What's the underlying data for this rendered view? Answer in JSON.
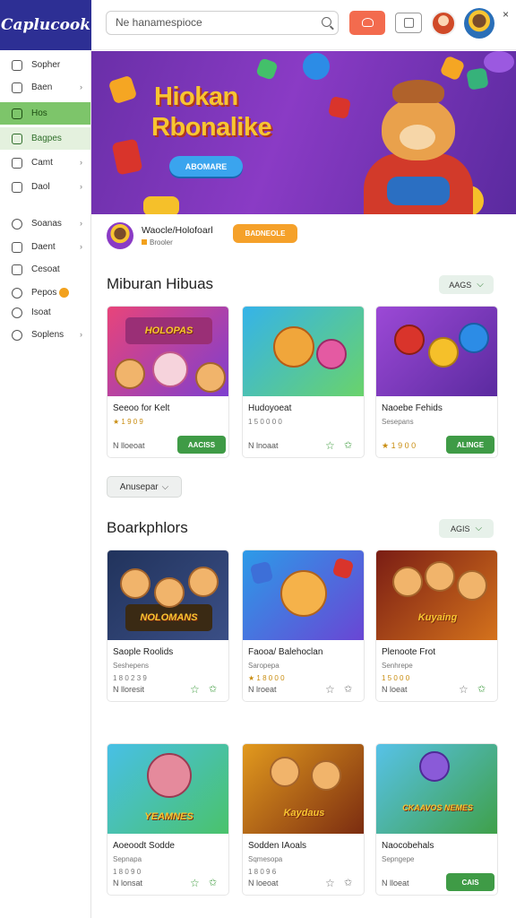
{
  "app": {
    "logo": "Caplucook"
  },
  "header": {
    "search_placeholder": "Ne hanamespioce",
    "close": "×"
  },
  "sidebar": {
    "items": [
      {
        "label": "Sopher",
        "chevron": ""
      },
      {
        "label": "Baen",
        "chevron": "›"
      },
      {
        "label": "Hos",
        "chevron": ""
      },
      {
        "label": "Bagpes",
        "chevron": ""
      },
      {
        "label": "Camt",
        "chevron": "›"
      },
      {
        "label": "Daol",
        "chevron": "›"
      },
      {
        "label": "Soanas",
        "chevron": "›"
      },
      {
        "label": "Daent",
        "chevron": "›"
      },
      {
        "label": "Cesoat",
        "chevron": ""
      },
      {
        "label": "Pepos",
        "chevron": ""
      },
      {
        "label": "Isoat",
        "chevron": ""
      },
      {
        "label": "Soplens",
        "chevron": "›"
      }
    ]
  },
  "hero": {
    "title_line1": "Hiokan",
    "title_line2": "Rbonalike",
    "button": "ABOMARE"
  },
  "promo": {
    "title": "Waocle/Holofoarl",
    "subtitle": "Brooler",
    "button": "BADNEOLE"
  },
  "section1": {
    "title": "Miburan Hibuas",
    "button": "AAGS",
    "cards": [
      {
        "thumb_text": "HOLOPAS",
        "title": "Seeoo for Kelt",
        "sub": "★ 1 9 0 9",
        "foot": "N lloeoat",
        "action": "AACISS"
      },
      {
        "title": "Hudoyoeat",
        "sub": "1 5 0 0 0 0",
        "foot": "N lnoaat"
      },
      {
        "title": "Naoebe Fehids",
        "sub": "Sesepans",
        "foot": "★ 1 9 0 0",
        "action": "ALINGE"
      }
    ]
  },
  "more_button": "Anusepar",
  "section2": {
    "title": "Boarkphlors",
    "button": "AGIS",
    "cards": [
      {
        "thumb_text": "NOLOMANS",
        "title": "Saople Roolids",
        "sub": "Seshepens",
        "foot": "N lloresit",
        "extra": "1 8 0 2 3 9"
      },
      {
        "title": "Faooa/ Balehoclan",
        "sub": "Saropepa",
        "foot": "N lroeat",
        "extra": "★ 1 8 0 0 0"
      },
      {
        "thumb_text": "Kuyaing",
        "title": "Plenoote Frot",
        "sub": "Senhrepe",
        "foot": "N loeat",
        "extra": "1 5 0 0 0"
      }
    ]
  },
  "section3": {
    "cards": [
      {
        "thumb_text": "YEAMNES",
        "title": "Aoeoodt Sodde",
        "sub": "Sepnapa",
        "foot": "N lonsat",
        "extra": "1 8 0 9 0"
      },
      {
        "thumb_text": "Kaydaus",
        "title": "Sodden IAoals",
        "sub": "Sqmesopa",
        "foot": "N loeoat",
        "extra": "1 8 0 9 6"
      },
      {
        "thumb_text": "CKAAVOS NEMES",
        "title": "Naocobehals",
        "sub": "Sepngepe",
        "foot": "N lloeat",
        "action": "CAIS"
      }
    ]
  }
}
